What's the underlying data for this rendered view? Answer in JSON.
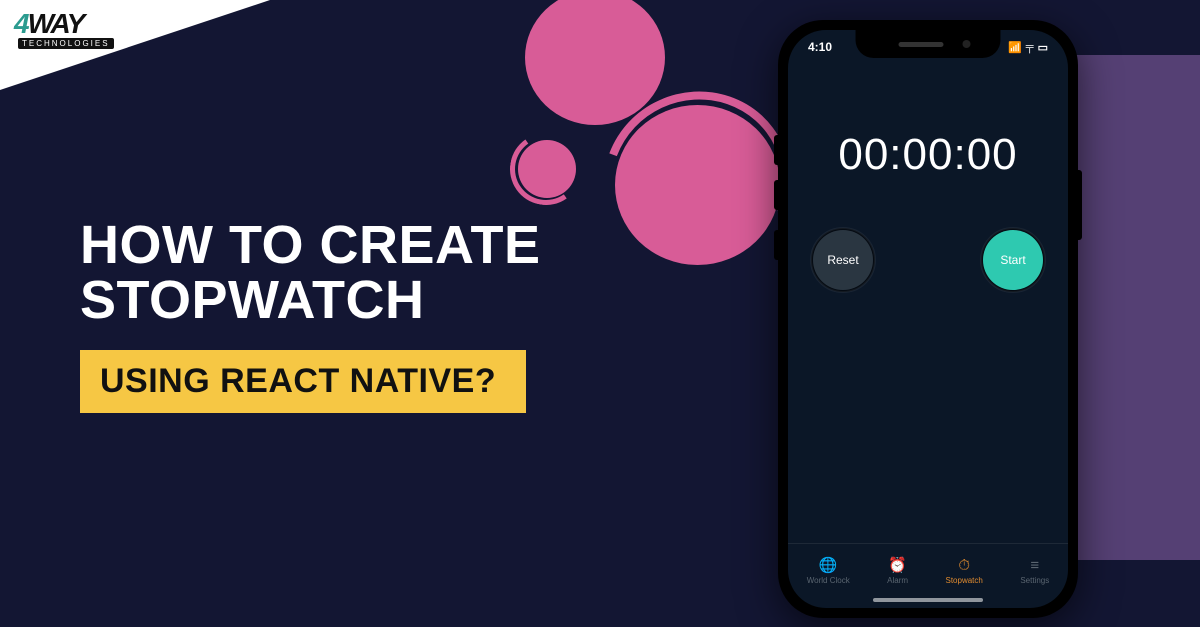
{
  "logo": {
    "mark_prefix": "4",
    "mark_suffix": "WAY",
    "sub": "TECHNOLOGIES"
  },
  "headline_line1": "HOW TO CREATE",
  "headline_line2": "STOPWATCH",
  "subheadline": "USING REACT NATIVE?",
  "phone": {
    "status_time": "4:10",
    "status_signal": "▮▮▮",
    "status_wifi": "▾",
    "status_battery": "▬",
    "timer": "00:00:00",
    "reset_label": "Reset",
    "start_label": "Start",
    "tabs": [
      {
        "icon": "🌐",
        "label": "World Clock"
      },
      {
        "icon": "⏰",
        "label": "Alarm"
      },
      {
        "icon": "⏱",
        "label": "Stopwatch"
      },
      {
        "icon": "≡",
        "label": "Settings"
      }
    ]
  },
  "colors": {
    "bg": "#131633",
    "accent_pink": "#d85c97",
    "accent_yellow": "#f6c744",
    "accent_purple": "#6c4f8b",
    "btn_start": "#2ec9b0"
  }
}
